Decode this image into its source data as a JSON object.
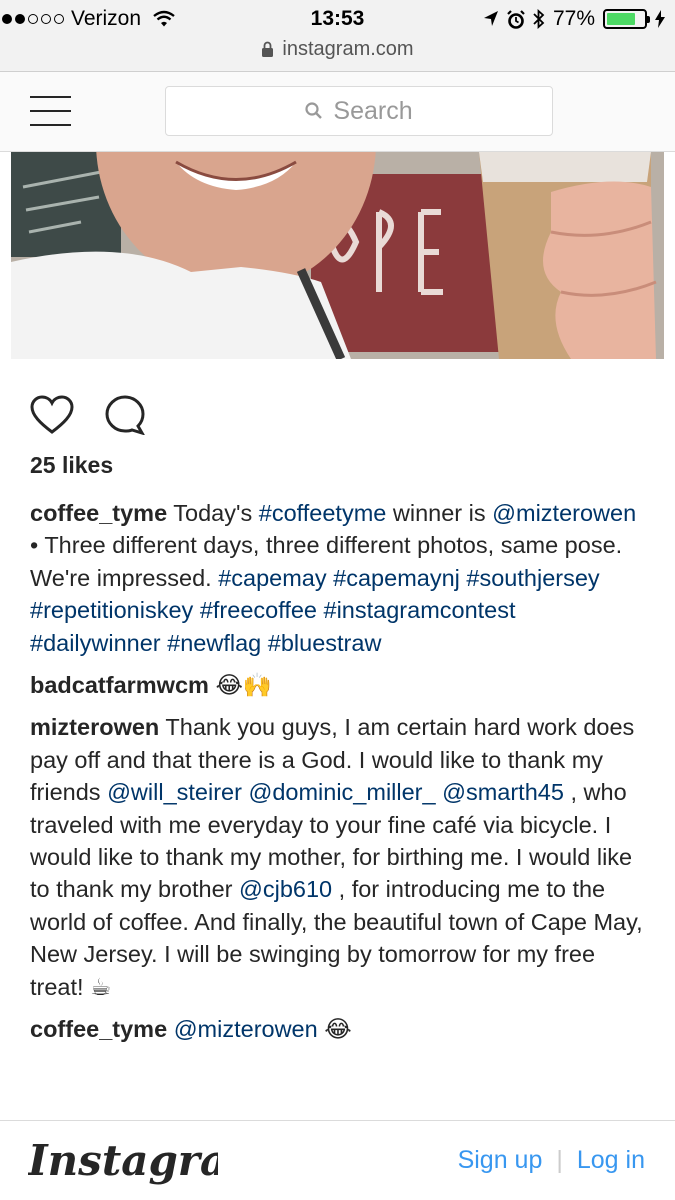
{
  "status_bar": {
    "carrier": "Verizon",
    "time": "13:53",
    "battery": "77%",
    "battery_level": 0.77,
    "signal_bars": 2,
    "icons": [
      "wifi-icon",
      "location-icon",
      "alarm-icon",
      "bluetooth-icon",
      "battery-icon",
      "charging-icon"
    ]
  },
  "browser": {
    "url": "instagram.com",
    "icons": [
      "lock-icon"
    ]
  },
  "header": {
    "search_placeholder": "Search",
    "icons": [
      "menu-icon",
      "search-icon"
    ]
  },
  "post": {
    "icons": [
      "heart-icon",
      "comment-icon"
    ],
    "likes": "25 likes",
    "comments": [
      {
        "user": "coffee_tyme",
        "parts": [
          {
            "text": "Today's ",
            "type": "text"
          },
          {
            "text": "#coffeetyme",
            "type": "link"
          },
          {
            "text": " winner is ",
            "type": "text"
          },
          {
            "text": "@mizterowen",
            "type": "link"
          },
          {
            "text": " • Three different days, three different photos, same pose. We're impressed. ",
            "type": "text"
          },
          {
            "text": "#capemay",
            "type": "link"
          },
          {
            "text": " ",
            "type": "text"
          },
          {
            "text": "#capemaynj",
            "type": "link"
          },
          {
            "text": " ",
            "type": "text"
          },
          {
            "text": "#southjersey",
            "type": "link"
          },
          {
            "text": " ",
            "type": "text"
          },
          {
            "text": "#repetitioniskey",
            "type": "link"
          },
          {
            "text": " ",
            "type": "text"
          },
          {
            "text": "#freecoffee",
            "type": "link"
          },
          {
            "text": " ",
            "type": "text"
          },
          {
            "text": "#instagramcontest",
            "type": "link"
          },
          {
            "text": " ",
            "type": "text"
          },
          {
            "text": "#dailywinner",
            "type": "link"
          },
          {
            "text": " ",
            "type": "text"
          },
          {
            "text": "#newflag",
            "type": "link"
          },
          {
            "text": " ",
            "type": "text"
          },
          {
            "text": "#bluestraw",
            "type": "link"
          }
        ]
      },
      {
        "user": "badcatfarmwcm",
        "parts": [
          {
            "text": "😂🙌",
            "type": "text"
          }
        ]
      },
      {
        "user": "mizterowen",
        "parts": [
          {
            "text": "Thank you guys, I am certain hard work does pay off and that there is a God. I would like to thank my friends ",
            "type": "text"
          },
          {
            "text": "@will_steirer",
            "type": "link"
          },
          {
            "text": " ",
            "type": "text"
          },
          {
            "text": "@dominic_miller_",
            "type": "link"
          },
          {
            "text": " ",
            "type": "text"
          },
          {
            "text": "@smarth45",
            "type": "link"
          },
          {
            "text": " , who traveled with me everyday to your fine café via bicycle. I would like to thank my mother, for birthing me. I would like to thank my brother ",
            "type": "text"
          },
          {
            "text": "@cjb610",
            "type": "link"
          },
          {
            "text": " , for introducing me to the world of coffee. And finally, the beautiful town of Cape May, New Jersey. I will be swinging by tomorrow for my free treat! ☕",
            "type": "text"
          }
        ]
      },
      {
        "user": "coffee_tyme",
        "parts": [
          {
            "text": "@mizterowen",
            "type": "link"
          },
          {
            "text": " 😂",
            "type": "text"
          }
        ]
      }
    ]
  },
  "footer": {
    "logo_text": "Instagram",
    "signup": "Sign up",
    "separator": "|",
    "login": "Log in"
  },
  "colors": {
    "link": "#003569",
    "accent": "#3897f0",
    "battery": "#4cd964"
  }
}
